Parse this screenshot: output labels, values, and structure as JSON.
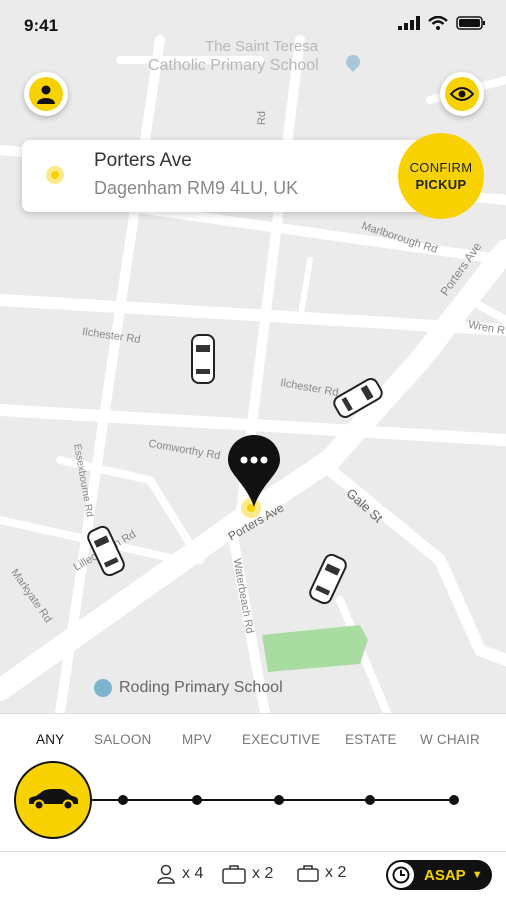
{
  "status_bar": {
    "time": "9:41"
  },
  "address": {
    "line1": "Porters Ave",
    "line2": "Dagenham RM9 4LU, UK"
  },
  "confirm_button": {
    "line1": "CONFIRM",
    "line2": "PICKUP"
  },
  "map_labels": {
    "school_top_line1": "The Saint Teresa",
    "school_top_line2": "Catholic Primary School",
    "school_bottom": "Roding Primary School",
    "ilchester_1": "Ilchester Rd",
    "ilchester_2": "Ilchester Rd",
    "comworthy": "Comworthy Rd",
    "porters_ave_center": "Porters Ave",
    "porters_ave_right": "Porters Ave",
    "gale_st": "Gale St",
    "marlborough": "Marlborough Rd",
    "wren": "Wren R",
    "waterbeach": "Waterbeach Rd",
    "lillechurch": "Lillechurch Rd",
    "markyate": "Markyate Rd",
    "essex": "Essexbourne Rd",
    "road_top": "Rd"
  },
  "vehicle_types": [
    "ANY",
    "SALOON",
    "MPV",
    "EXECUTIVE",
    "ESTATE",
    "W CHAIR"
  ],
  "selected_vehicle": "ANY",
  "options": {
    "passengers": "x 4",
    "large_bags": "x 2",
    "small_bags": "x 2"
  },
  "time_select": {
    "label": "ASAP"
  },
  "colors": {
    "accent": "#f7d200",
    "dark": "#111111"
  }
}
